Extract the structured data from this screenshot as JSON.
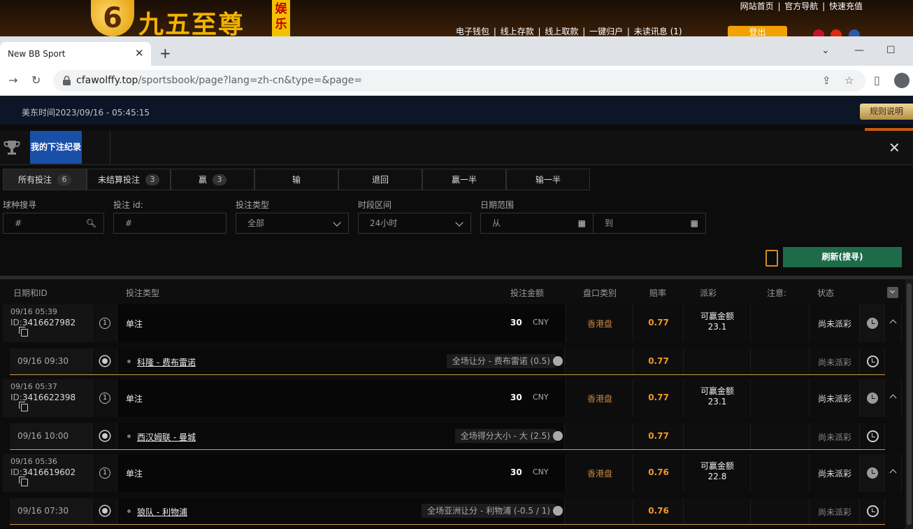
{
  "site": {
    "logo_digit": "6",
    "logo_text": "九五至尊",
    "logo_badge": "娱乐",
    "top_links": [
      "网站首页",
      "官方导航",
      "快速充值"
    ],
    "bottom_links": [
      "电子钱包",
      "线上存款",
      "线上取款",
      "一键归户",
      "未读讯息 (1)"
    ],
    "login_label": "登出"
  },
  "browser": {
    "tab_title": "New BB Sport",
    "url_host": "cfawolffy.top",
    "url_path": "/sportsbook/page?lang=zh-cn&type=&page="
  },
  "header": {
    "time_text": "美东时间2023/09/16 - 05:45:15",
    "rules_label": "规则说明"
  },
  "panel": {
    "title": "我的下注纪录",
    "tabs": [
      {
        "label": "所有投注",
        "count": "6"
      },
      {
        "label": "未结算投注",
        "count": "3"
      },
      {
        "label": "赢",
        "count": "3"
      },
      {
        "label": "输",
        "count": ""
      },
      {
        "label": "退回",
        "count": ""
      },
      {
        "label": "赢一半",
        "count": ""
      },
      {
        "label": "输一半",
        "count": ""
      }
    ],
    "filters": {
      "sport_label": "球种搜寻",
      "sport_placeholder": "#",
      "betid_label": "投注 id:",
      "betid_placeholder": "#",
      "bettype_label": "投注类型",
      "bettype_value": "全部",
      "period_label": "时段区间",
      "period_value": "24小时",
      "date_label": "日期范围",
      "date_from": "从",
      "date_to": "到"
    },
    "refresh_label": "刷新(搜寻)"
  },
  "table": {
    "headers": {
      "date_id": "日期和ID",
      "bet_type": "投注类型",
      "amount": "投注金额",
      "market": "盘口类别",
      "odds": "赔率",
      "payout": "派彩",
      "note": "注意:",
      "status": "状态"
    },
    "id_label": "ID:",
    "bets": [
      {
        "date": "09/16 05:39",
        "id": "3416627982",
        "type_num": "1",
        "type": "单注",
        "amount": "30",
        "currency": "CNY",
        "market": "香港盘",
        "odds": "0.77",
        "win_label": "可赢金额",
        "win_amount": "23.1",
        "status": "尚未派彩",
        "leg": {
          "date": "09/16 09:30",
          "match": "科隆 - 费布雷诺",
          "selection": "全场让分 - 费布雷诺 (0.5)",
          "odds": "0.77",
          "status": "尚未派彩"
        }
      },
      {
        "date": "09/16 05:37",
        "id": "3416622398",
        "type_num": "1",
        "type": "单注",
        "amount": "30",
        "currency": "CNY",
        "market": "香港盘",
        "odds": "0.77",
        "win_label": "可赢金额",
        "win_amount": "23.1",
        "status": "尚未派彩",
        "leg": {
          "date": "09/16 10:00",
          "match": "西汉姆联 - 曼城",
          "selection": "全场得分大小 - 大 (2.5)",
          "odds": "0.77",
          "status": "尚未派彩"
        }
      },
      {
        "date": "09/16 05:36",
        "id": "3416619602",
        "type_num": "1",
        "type": "单注",
        "amount": "30",
        "currency": "CNY",
        "market": "香港盘",
        "odds": "0.76",
        "win_label": "可赢金额",
        "win_amount": "22.8",
        "status": "尚未派彩",
        "leg": {
          "date": "09/16 07:30",
          "match": "狼队 - 利物浦",
          "selection": "全场亚洲让分 - 利物浦 (-0.5 / 1)",
          "odds": "0.76",
          "status": "尚未派彩"
        }
      }
    ]
  }
}
